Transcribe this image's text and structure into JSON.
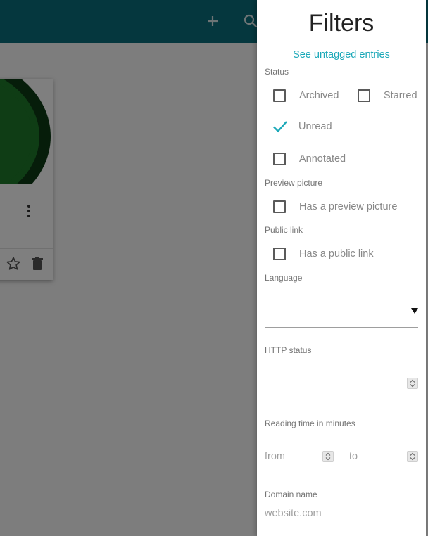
{
  "appbar": {
    "add_icon": "plus-icon",
    "search_icon": "search-icon",
    "color": "#0b6f7d"
  },
  "card": {
    "thumbnail_colors": [
      "#0d3a14",
      "#1e7a2a"
    ],
    "menu_icon": "more-vertical-icon",
    "star_icon": "star-outline-icon",
    "delete_icon": "trash-icon"
  },
  "filters": {
    "title": "Filters",
    "untagged_link": "See untagged entries",
    "status_label": "Status",
    "archived": {
      "label": "Archived",
      "checked": false
    },
    "starred": {
      "label": "Starred",
      "checked": false
    },
    "unread": {
      "label": "Unread",
      "checked": true
    },
    "annotated": {
      "label": "Annotated",
      "checked": false
    },
    "preview_label": "Preview picture",
    "has_preview": {
      "label": "Has a preview picture",
      "checked": false
    },
    "public_link_label": "Public link",
    "has_public_link": {
      "label": "Has a public link",
      "checked": false
    },
    "language_label": "Language",
    "language_value": "",
    "http_status_label": "HTTP status",
    "http_status_value": "",
    "reading_time_label": "Reading time in minutes",
    "reading_from_placeholder": "from",
    "reading_to_placeholder": "to",
    "domain_label": "Domain name",
    "domain_placeholder": "website.com",
    "accent_color": "#1aa8b8"
  }
}
